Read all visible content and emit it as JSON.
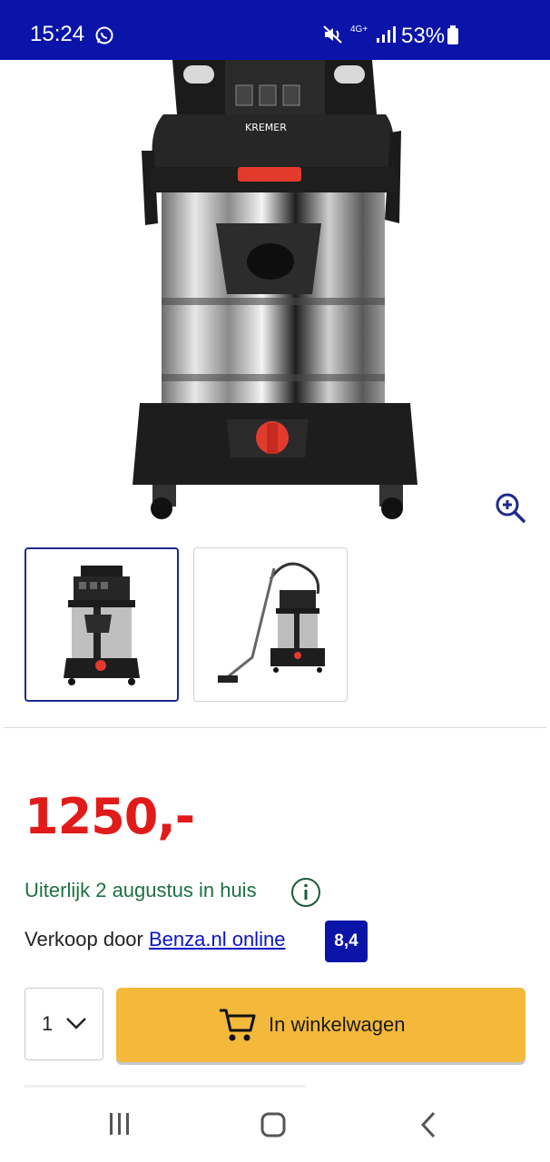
{
  "status_bar": {
    "time": "15:24",
    "network": "4G+",
    "battery": "53%",
    "background": "#0a14a8"
  },
  "product": {
    "brand_on_image": "KREMER",
    "price": "1250,-",
    "delivery": "Uiterlijk 2 augustus in huis",
    "seller_prefix": "Verkoop door ",
    "seller_name": "Benza.nl online",
    "seller_rating": "8,4"
  },
  "thumbnails": [
    {
      "icon": "vacuum-front-thumbnail",
      "selected": true
    },
    {
      "icon": "vacuum-with-hose-thumbnail",
      "selected": false
    }
  ],
  "purchase": {
    "quantity": "1",
    "cart_button_label": "In winkelwagen",
    "cart_button_color": "#f4b93b"
  },
  "colors": {
    "price": "#e11a1a",
    "delivery": "#1e6f43",
    "link": "#0a14c8",
    "badge": "#0a14a8"
  }
}
